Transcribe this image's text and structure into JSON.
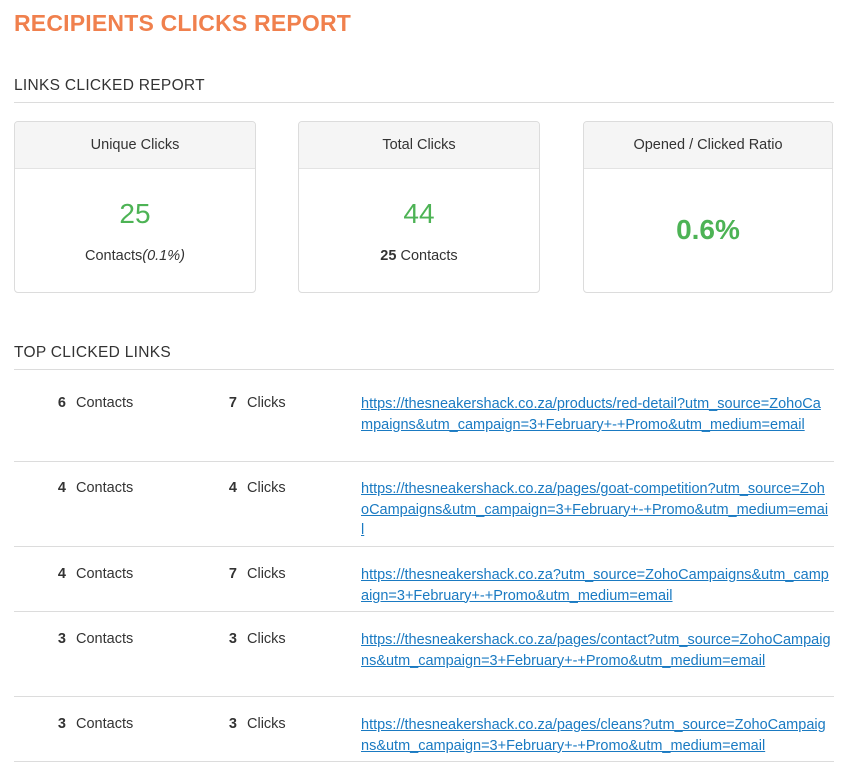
{
  "page_title": "RECIPIENTS CLICKS REPORT",
  "links_clicked_section": {
    "title": "LINKS CLICKED REPORT",
    "cards": [
      {
        "label": "Unique Clicks",
        "value": "25",
        "sub_prefix": "Contacts",
        "sub_pct": "(0.1%)"
      },
      {
        "label": "Total Clicks",
        "value": "44",
        "sub_count": "25",
        "sub_suffix": " Contacts"
      },
      {
        "label": "Opened / Clicked Ratio",
        "value": "0.6%"
      }
    ]
  },
  "top_links_section": {
    "title": "TOP CLICKED LINKS",
    "rows": [
      {
        "contacts": "6",
        "contacts_label": "Contacts",
        "clicks": "7",
        "clicks_label": "Clicks",
        "url": "https://thesneakershack.co.za/products/red-detail?utm_source=ZohoCampaigns&utm_campaign=3+February+-+Promo&utm_medium=email"
      },
      {
        "contacts": "4",
        "contacts_label": "Contacts",
        "clicks": "4",
        "clicks_label": "Clicks",
        "url": "https://thesneakershack.co.za/pages/goat-competition?utm_source=ZohoCampaigns&utm_campaign=3+February+-+Promo&utm_medium=email"
      },
      {
        "contacts": "4",
        "contacts_label": "Contacts",
        "clicks": "7",
        "clicks_label": "Clicks",
        "url": "https://thesneakershack.co.za?utm_source=ZohoCampaigns&utm_campaign=3+February+-+Promo&utm_medium=email"
      },
      {
        "contacts": "3",
        "contacts_label": "Contacts",
        "clicks": "3",
        "clicks_label": "Clicks",
        "url": "https://thesneakershack.co.za/pages/contact?utm_source=ZohoCampaigns&utm_campaign=3+February+-+Promo&utm_medium=email"
      },
      {
        "contacts": "3",
        "contacts_label": "Contacts",
        "clicks": "3",
        "clicks_label": "Clicks",
        "url": "https://thesneakershack.co.za/pages/cleans?utm_source=ZohoCampaigns&utm_campaign=3+February+-+Promo&utm_medium=email"
      }
    ]
  },
  "colors": {
    "title_accent": "#f0804d",
    "stat_green": "#4db355",
    "link_blue": "#1a7ac2"
  }
}
